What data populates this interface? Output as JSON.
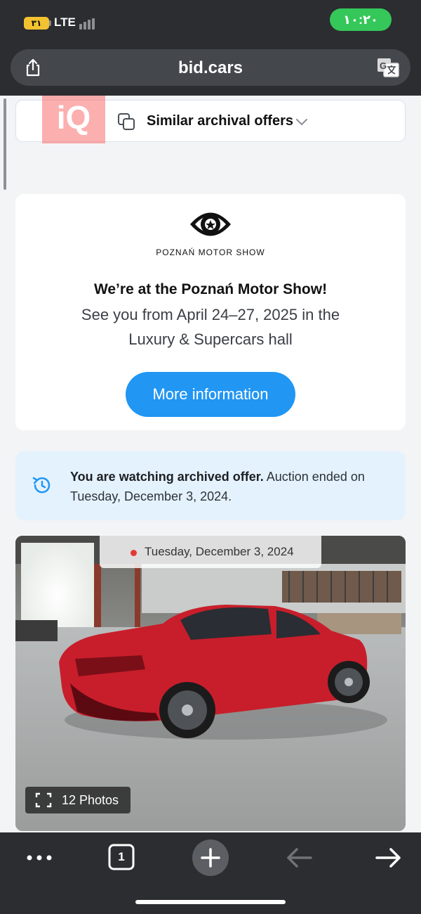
{
  "status_bar": {
    "battery_level": "٣١",
    "network": "LTE",
    "time": "١٠:٢٠",
    "accent_color": "#35c759"
  },
  "browser": {
    "url": "bid.cars",
    "share_icon": "share-icon",
    "translate_icon": "translate-icon"
  },
  "similar_offers": {
    "watermark": "iQ",
    "label": "Similar archival offers",
    "icon": "copy-icon"
  },
  "promo": {
    "logo_text": "POZNAŃ MOTOR SHOW",
    "title": "We’re at the Poznań Motor Show!",
    "text": "See you from April 24–27, 2025 in the Luxury & Supercars hall",
    "button_label": "More information",
    "button_color": "#2196f3"
  },
  "archive_notice": {
    "bold_text": "You are watching archived offer.",
    "text": " Auction ended on Tuesday, December 3, 2024.",
    "icon": "history-icon"
  },
  "gallery": {
    "date": "Tuesday, December 3, 2024",
    "photos_label": "12 Photos",
    "car_color": "#c81e2b"
  },
  "toolbar": {
    "tab_count": "1",
    "icons": [
      "more-icon",
      "tabs-icon",
      "new-tab-icon",
      "back-icon",
      "forward-icon"
    ]
  }
}
